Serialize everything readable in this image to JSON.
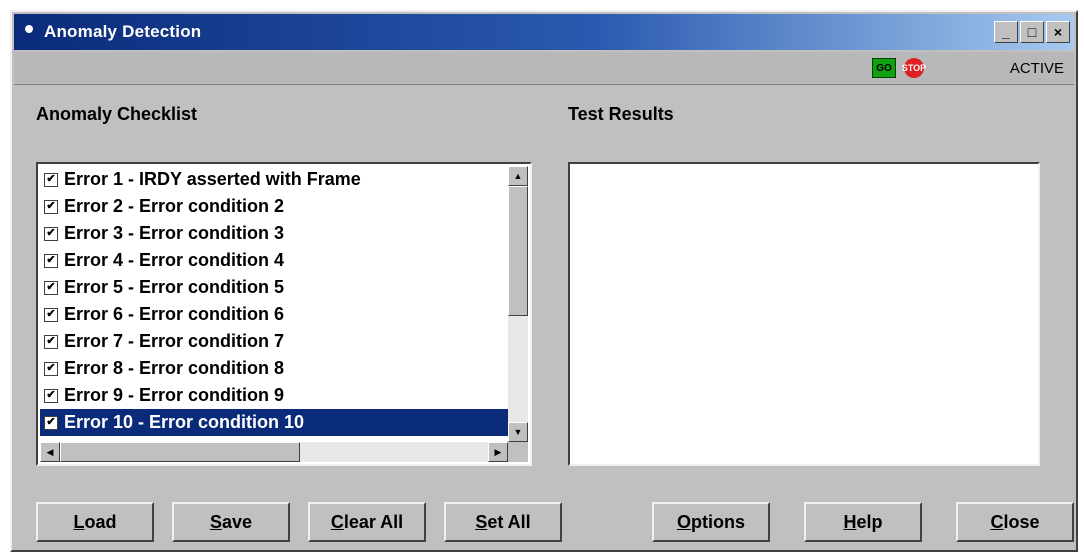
{
  "window": {
    "title": "Anomaly Detection",
    "controls": {
      "minimize": "_",
      "maximize": "□",
      "close": "×"
    }
  },
  "status_strip": {
    "go_icon_label": "GO",
    "stop_icon_label": "STOP",
    "state_text": "ACTIVE"
  },
  "checklist": {
    "label": "Anomaly Checklist",
    "items": [
      {
        "label": "Error 1 - IRDY asserted with Frame",
        "checked": true
      },
      {
        "label": "Error 2 - Error condition 2",
        "checked": true
      },
      {
        "label": "Error 3 - Error condition 3",
        "checked": true
      },
      {
        "label": "Error 4 - Error condition 4",
        "checked": true
      },
      {
        "label": "Error 5 - Error condition 5",
        "checked": true
      },
      {
        "label": "Error 6 - Error condition 6",
        "checked": true
      },
      {
        "label": "Error 7 - Error condition 7",
        "checked": true
      },
      {
        "label": "Error 8 - Error condition 8",
        "checked": true
      },
      {
        "label": "Error 9 - Error condition 9",
        "checked": true
      },
      {
        "label": "Error 10 - Error condition 10",
        "checked": true,
        "selected": true
      }
    ]
  },
  "results": {
    "label": "Test Results"
  },
  "buttons": {
    "load": {
      "mnemonic": "L",
      "rest": "oad"
    },
    "save": {
      "mnemonic": "S",
      "rest": "ave"
    },
    "clear_all": {
      "mnemonic": "C",
      "rest": "lear All"
    },
    "set_all": {
      "mnemonic": "S",
      "rest": "et All"
    },
    "options": {
      "mnemonic": "O",
      "rest": "ptions"
    },
    "help": {
      "mnemonic": "H",
      "rest": "elp"
    },
    "close": {
      "mnemonic": "C",
      "rest": "lose"
    }
  },
  "colors": {
    "title_bar_start": "#0a2a7a",
    "selection": "#0a2a7a",
    "face": "#c0c0c0"
  }
}
